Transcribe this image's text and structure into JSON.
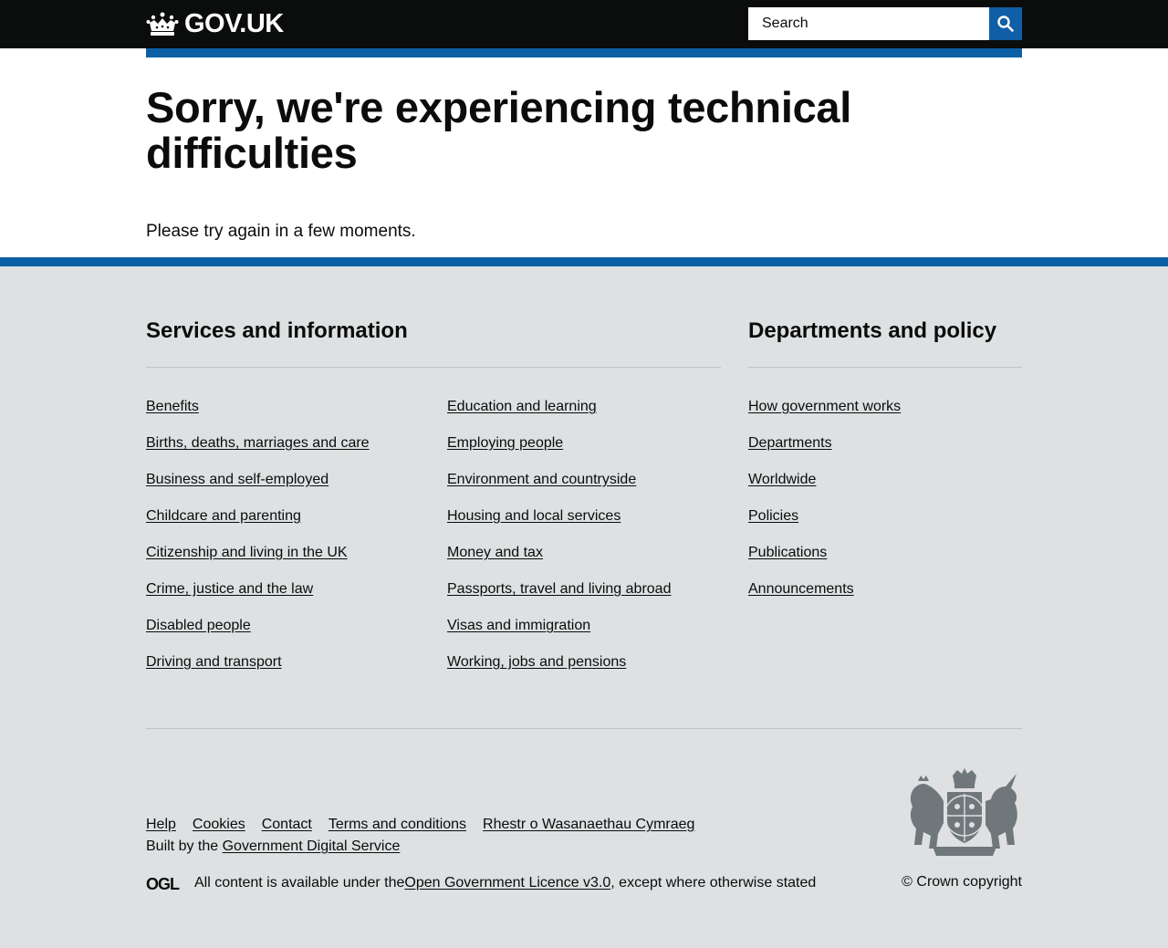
{
  "header": {
    "logo_text": "GOV.UK",
    "search_placeholder": "Search",
    "colors": {
      "background": "#0b0c0c",
      "accent": "#0b5fa5",
      "search_button": "#0f5fa6"
    }
  },
  "main": {
    "title": "Sorry, we're experiencing technical difficulties",
    "body": "Please try again in a few moments."
  },
  "footer": {
    "background": "#dee0e2",
    "services": {
      "heading": "Services and information",
      "column_1": [
        "Benefits",
        "Births, deaths, marriages and care",
        "Business and self-employed",
        "Childcare and parenting",
        "Citizenship and living in the UK",
        "Crime, justice and the law",
        "Disabled people",
        "Driving and transport"
      ],
      "column_2": [
        "Education and learning",
        "Employing people",
        "Environment and countryside",
        "Housing and local services",
        "Money and tax",
        "Passports, travel and living abroad",
        "Visas and immigration",
        "Working, jobs and pensions"
      ]
    },
    "departments": {
      "heading": "Departments and policy",
      "items": [
        "How government works",
        "Departments",
        "Worldwide",
        "Policies",
        "Publications",
        "Announcements"
      ]
    },
    "meta_links": [
      "Help",
      "Cookies",
      "Contact",
      "Terms and conditions",
      "Rhestr o Wasanaethau Cymraeg"
    ],
    "built_by_prefix": "Built by the ",
    "built_by_link": "Government Digital Service",
    "licence_prefix": "All content is available under the ",
    "licence_link": "Open Government Licence v3.0",
    "licence_suffix": ", except where otherwise stated",
    "copyright": "© Crown copyright",
    "ogl_logo_text": "OGL"
  }
}
